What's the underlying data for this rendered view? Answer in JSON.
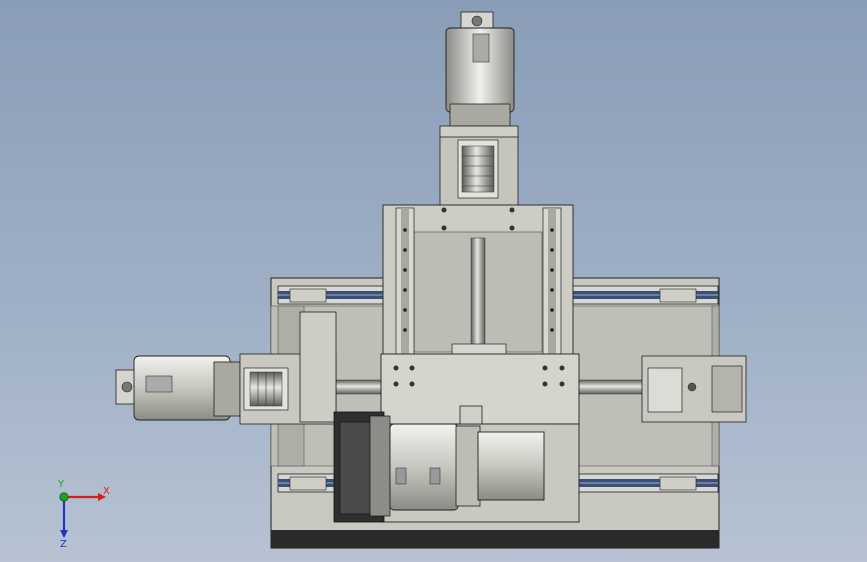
{
  "viewport": {
    "background_top": "#8a9db7",
    "background_bottom": "#b7c3d3"
  },
  "model": {
    "parts": [
      "base-plate",
      "x-linear-rail-top",
      "x-linear-rail-bottom",
      "y-axis-servo-motor",
      "y-axis-coupling",
      "y-axis-ball-screw",
      "z-axis-column",
      "z-axis-linear-rail-left",
      "z-axis-linear-rail-right",
      "carriage-block",
      "x-axis-servo-motor",
      "x-axis-coupling",
      "x-axis-ball-screw",
      "x-axis-end-bearing-block",
      "spindle-servo-motor",
      "gear-reducer"
    ],
    "colors": {
      "metal_light": "#d3d3cc",
      "metal_mid": "#bdbdb6",
      "metal_dark": "#6e6e6a",
      "plate_dark": "#2a2a2a",
      "rail_blue": "#3b5078",
      "outline": "#1f1f1f"
    }
  },
  "triad": {
    "x_label": "X",
    "y_label": "Y",
    "z_label": "Z",
    "x_color": "#d62020",
    "y_color": "#1aa51a",
    "z_color": "#2233cc",
    "origin_icon": "triad-origin-icon"
  }
}
